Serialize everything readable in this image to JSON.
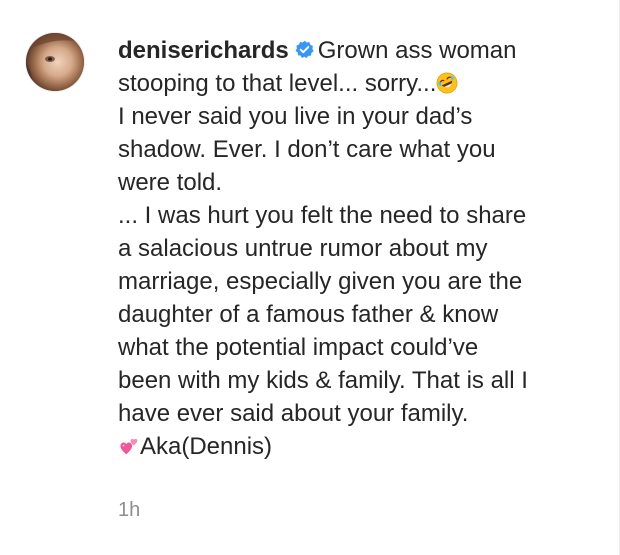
{
  "comment": {
    "username": "deniserichards",
    "verified_icon": "verified-badge-icon",
    "first_line_text": "Grown ass woman",
    "lines": [
      "stooping to that level... sorry...",
      "I never said you live in your dad’s",
      "shadow. Ever. I don’t care what you",
      "were told.",
      "... I was hurt you felt the need to share",
      "a salacious untrue rumor about my",
      "marriage, especially given you are the",
      "daughter of a famous father & know",
      "what the potential impact could’ve",
      "been with my kids & family. That is all I",
      "have ever said about your family.",
      "Aka(Dennis)"
    ],
    "emoji_laughing": "rolling-on-floor-laughing-emoji",
    "emoji_hearts": "two-hearts-emoji",
    "timestamp": "1h"
  },
  "colors": {
    "text": "#262626",
    "muted": "#8e8e8e",
    "verified_blue": "#3897f0"
  }
}
